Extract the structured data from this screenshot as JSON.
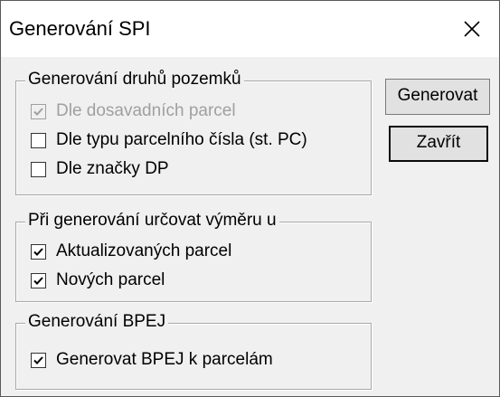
{
  "window": {
    "title": "Generování SPI",
    "close_icon": "close-icon"
  },
  "group_land_types": {
    "title": "Generování druhů pozemků",
    "items": [
      {
        "label": "Dle dosavadních parcel",
        "checked": true,
        "disabled": true
      },
      {
        "label": "Dle typu parcelního čísla (st. PC)",
        "checked": false,
        "disabled": false
      },
      {
        "label": "Dle značky DP",
        "checked": false,
        "disabled": false
      }
    ]
  },
  "group_area": {
    "title": "Při generování určovat výměru u",
    "items": [
      {
        "label": "Aktualizovaných parcel",
        "checked": true,
        "disabled": false
      },
      {
        "label": "Nových parcel",
        "checked": true,
        "disabled": false
      }
    ]
  },
  "group_bpej": {
    "title": "Generování BPEJ",
    "items": [
      {
        "label": "Generovat BPEJ k parcelám",
        "checked": true,
        "disabled": false
      }
    ]
  },
  "buttons": {
    "generate": "Generovat",
    "close": "Zavřít"
  }
}
